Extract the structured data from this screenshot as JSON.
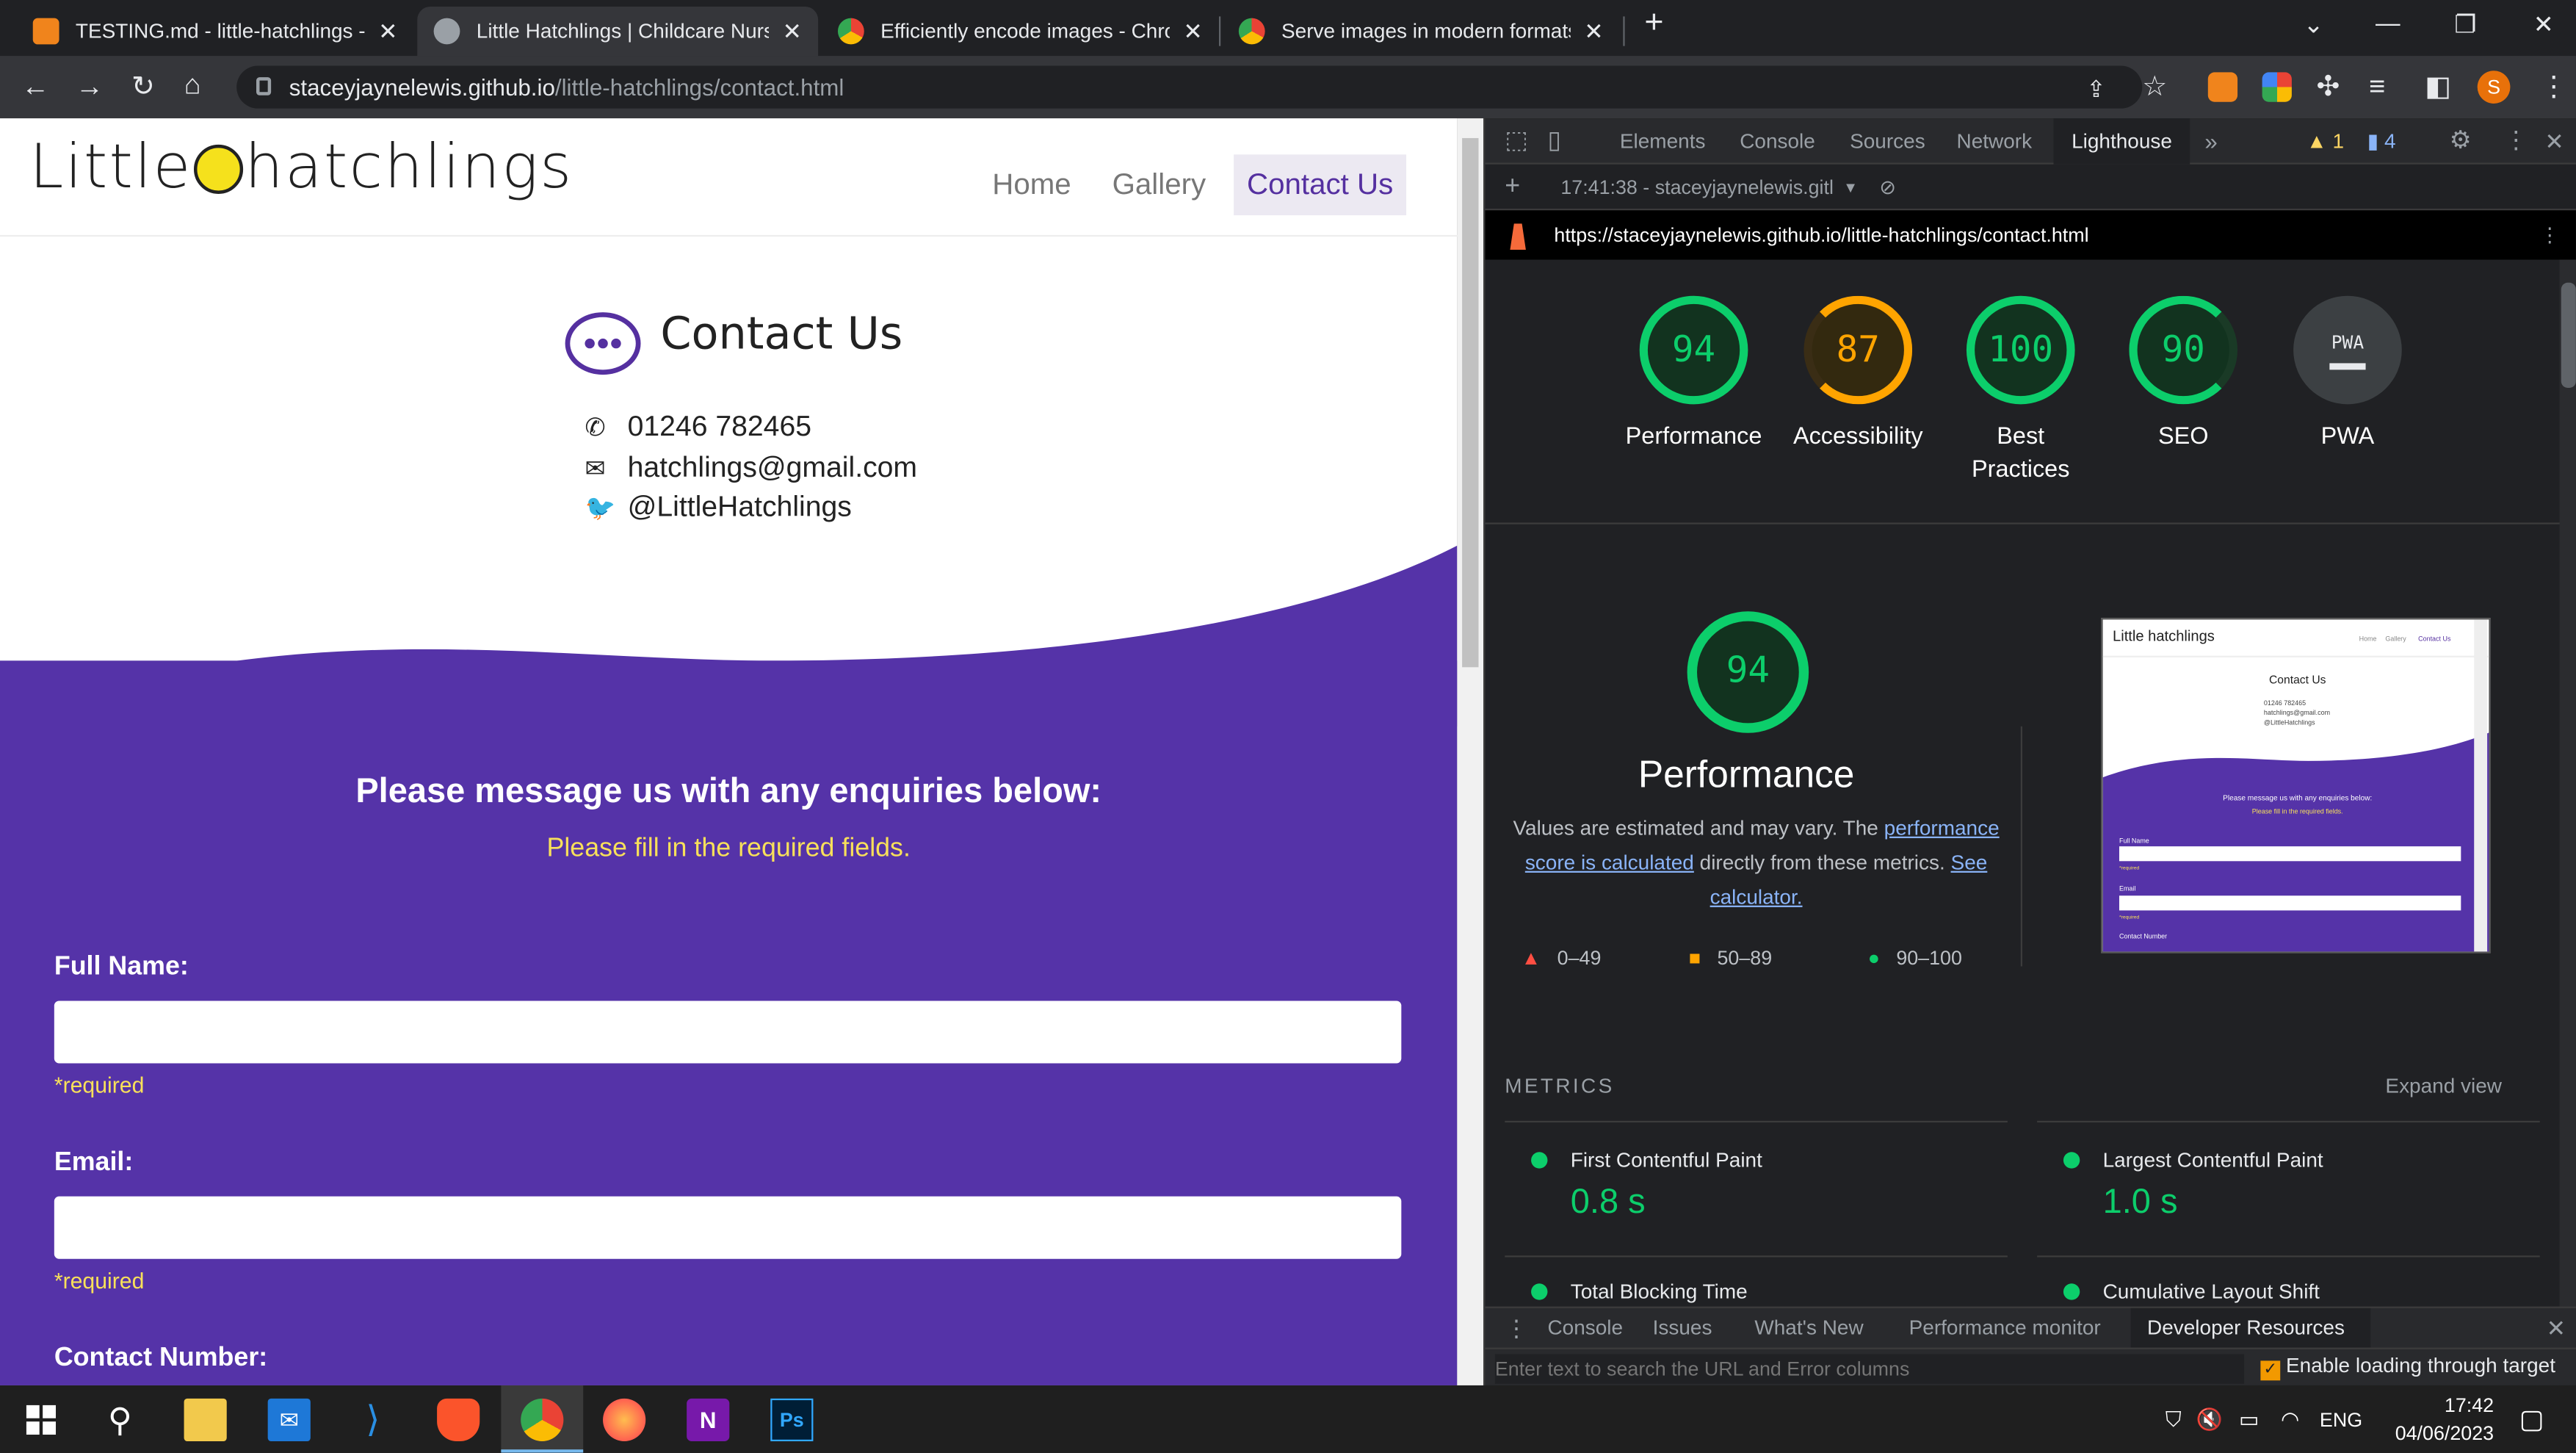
{
  "browser": {
    "tabs": [
      {
        "title": "TESTING.md - little-hatchlings - G",
        "active": false
      },
      {
        "title": "Little Hatchlings | Childcare Nurse",
        "active": true
      },
      {
        "title": "Efficiently encode images - Chrom",
        "active": false
      },
      {
        "title": "Serve images in modern formats",
        "active": false
      }
    ],
    "new_tab": "+",
    "url_domain": "staceyjaynelewis.github.io",
    "url_path": "/little-hatchlings/contact.html",
    "profile_initial": "S"
  },
  "site": {
    "logo_left": "Little",
    "logo_right": "hatchlings",
    "nav": [
      "Home",
      "Gallery",
      "Contact Us"
    ],
    "contact_title": "Contact Us",
    "phone": "01246 782465",
    "email": "hatchlings@gmail.com",
    "twitter": "@LittleHatchlings",
    "message_heading": "Please message us with any enquiries below:",
    "required_note": "Please fill in the required fields.",
    "fields": [
      {
        "label": "Full Name:",
        "required": "*required"
      },
      {
        "label": "Email:",
        "required": "*required"
      },
      {
        "label": "Contact Number:",
        "required": ""
      }
    ]
  },
  "devtools": {
    "tabs": [
      "Elements",
      "Console",
      "Sources",
      "Network",
      "Lighthouse"
    ],
    "more": "»",
    "warn_count": "1",
    "msg_count": "4",
    "report_time": "17:41:38 - staceyjaynelewis.gitl",
    "report_url": "https://staceyjaynelewis.github.io/little-hatchlings/contact.html",
    "scores": [
      {
        "value": "94",
        "label": "Performance",
        "color": "#0cce6b"
      },
      {
        "value": "87",
        "label": "Accessibility",
        "color": "#ffa400"
      },
      {
        "value": "100",
        "label": "Best Practices",
        "color": "#0cce6b"
      },
      {
        "value": "90",
        "label": "SEO",
        "color": "#0cce6b"
      },
      {
        "value": "PWA",
        "label": "PWA",
        "color": "#9aa0a6"
      }
    ],
    "perf_score": "94",
    "perf_title": "Performance",
    "perf_text_1": "Values are estimated and may vary. The ",
    "perf_link_1": "performance score is calculated",
    "perf_text_2": " directly from these metrics. ",
    "perf_link_2": "See calculator.",
    "legend": [
      "0–49",
      "50–89",
      "90–100"
    ],
    "metrics_header": "METRICS",
    "expand_view": "Expand view",
    "metrics": [
      {
        "name": "First Contentful Paint",
        "value": "0.8 s"
      },
      {
        "name": "Largest Contentful Paint",
        "value": "1.0 s"
      },
      {
        "name": "Total Blocking Time",
        "value": ""
      },
      {
        "name": "Cumulative Layout Shift",
        "value": ""
      }
    ],
    "drawer_tabs": [
      "Console",
      "Issues",
      "What's New",
      "Performance monitor",
      "Developer Resources"
    ],
    "drawer_search_placeholder": "Enter text to search the URL and Error columns",
    "drawer_checkbox": "Enable loading through target"
  },
  "thumbnail": {
    "logo": "Little hatchlings",
    "nav": [
      "Home",
      "Gallery",
      "Contact Us"
    ],
    "contact_title": "Contact Us",
    "lines": [
      "01246 782465",
      "hatchlings@gmail.com",
      "@LittleHatchlings"
    ],
    "message": "Please message us with any enquiries below:",
    "required": "Please fill in the required fields.",
    "fields": [
      "Full Name",
      "Email",
      "Contact Number"
    ],
    "required_tag": "*required"
  },
  "taskbar": {
    "lang": "ENG",
    "time": "17:42",
    "date": "04/06/2023"
  }
}
